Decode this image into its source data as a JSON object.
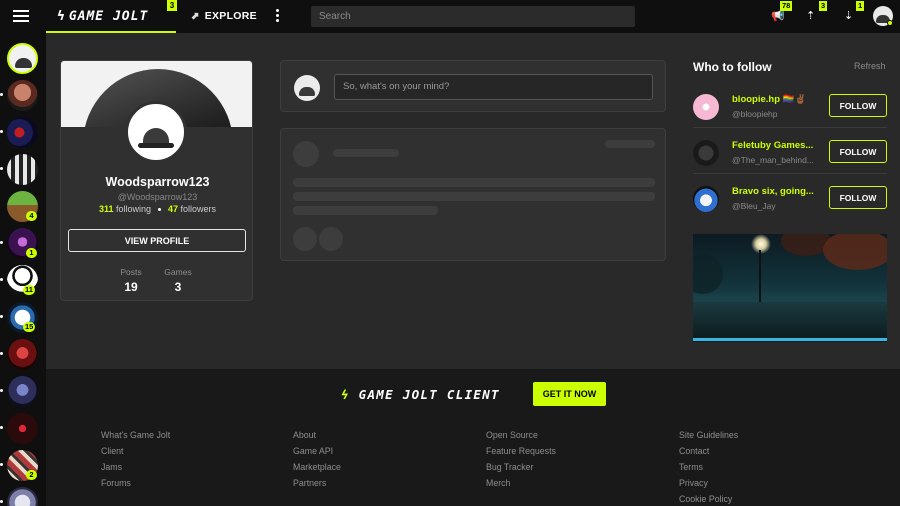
{
  "topbar": {
    "logo_text": "GAME JOLT",
    "logo_badge": "3",
    "explore_label": "EXPLORE",
    "search_placeholder": "Search",
    "notif_badges": [
      "78",
      "3",
      "1"
    ],
    "accent_color": "#ccff00"
  },
  "sidebar_games": [
    {
      "name": "user-avatar",
      "badge": ""
    },
    {
      "name": "game-1",
      "badge": ""
    },
    {
      "name": "game-2",
      "badge": ""
    },
    {
      "name": "game-3",
      "badge": ""
    },
    {
      "name": "game-4",
      "badge": "4"
    },
    {
      "name": "game-5",
      "badge": "1"
    },
    {
      "name": "game-6",
      "badge": "11"
    },
    {
      "name": "game-7",
      "badge": "15"
    },
    {
      "name": "game-8",
      "badge": ""
    },
    {
      "name": "game-9",
      "badge": ""
    },
    {
      "name": "game-10",
      "badge": ""
    },
    {
      "name": "game-11",
      "badge": "2"
    },
    {
      "name": "game-12",
      "badge": ""
    }
  ],
  "profile": {
    "name": "Woodsparrow123",
    "handle": "@Woodsparrow123",
    "following_count": "311",
    "following_label": "following",
    "followers_count": "47",
    "followers_label": "followers",
    "view_profile_label": "VIEW PROFILE",
    "posts_label": "Posts",
    "posts_value": "19",
    "games_label": "Games",
    "games_value": "3"
  },
  "composer": {
    "placeholder": "So, what's on your mind?"
  },
  "who_to_follow": {
    "title": "Who to follow",
    "refresh_label": "Refresh",
    "users": [
      {
        "name": "bloopie.hp 🏳️‍🌈✌🏾",
        "handle": "@bloopiehp",
        "button": "FOLLOW"
      },
      {
        "name": "Feletuby Games...",
        "handle": "@The_man_behind...",
        "button": "FOLLOW"
      },
      {
        "name": "Bravo six, going...",
        "handle": "@Bleu_Jay",
        "button": "FOLLOW"
      }
    ]
  },
  "footer": {
    "client_logo": "GAME JOLT CLIENT",
    "get_it_now": "GET IT NOW",
    "columns": [
      [
        "What's Game Jolt",
        "Client",
        "Jams",
        "Forums"
      ],
      [
        "About",
        "Game API",
        "Marketplace",
        "Partners"
      ],
      [
        "Open Source",
        "Feature Requests",
        "Bug Tracker",
        "Merch"
      ],
      [
        "Site Guidelines",
        "Contact",
        "Terms",
        "Privacy",
        "Cookie Policy"
      ]
    ]
  }
}
